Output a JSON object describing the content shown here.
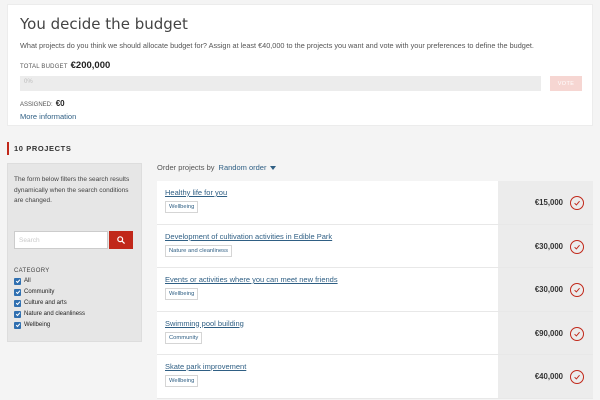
{
  "budget": {
    "title": "You decide the budget",
    "description": "What projects do you think we should allocate budget for? Assign at least €40,000 to the projects you want and vote with your preferences to define the budget.",
    "total_label": "TOTAL BUDGET",
    "total_value": "€200,000",
    "progress_text": "0%",
    "progress_percent": 0,
    "vote_label": "VOTE",
    "assigned_label": "ASSIGNED:",
    "assigned_value": "€0",
    "more_info": "More information"
  },
  "projects": {
    "heading": "10 PROJECTS",
    "order_label": "Order projects by",
    "order_value": "Random order",
    "items": [
      {
        "title": "Healthy life for you",
        "tag": "Wellbeing",
        "price": "€15,000"
      },
      {
        "title": "Development of cultivation activities in Edible Park",
        "tag": "Nature and cleanliness",
        "price": "€30,000"
      },
      {
        "title": "Events or activities where you can meet new friends",
        "tag": "Wellbeing",
        "price": "€30,000"
      },
      {
        "title": "Swimming pool building",
        "tag": "Community",
        "price": "€90,000"
      },
      {
        "title": "Skate park improvement",
        "tag": "Wellbeing",
        "price": "€40,000"
      }
    ]
  },
  "filters": {
    "help_text": "The form below filters the search results dynamically when the search conditions are changed.",
    "search_placeholder": "Search",
    "category_label": "CATEGORY",
    "categories": [
      {
        "label": "All",
        "checked": true
      },
      {
        "label": "Community",
        "checked": true
      },
      {
        "label": "Culture and arts",
        "checked": true
      },
      {
        "label": "Nature and cleanliness",
        "checked": true
      },
      {
        "label": "Wellbeing",
        "checked": true
      }
    ]
  },
  "icons": {
    "search": "search-icon",
    "check": "check-icon",
    "caret": "chevron-down-icon"
  },
  "colors": {
    "accent": "#c1281a",
    "link": "#2f5f84",
    "checkbox": "#2f6fb0"
  }
}
